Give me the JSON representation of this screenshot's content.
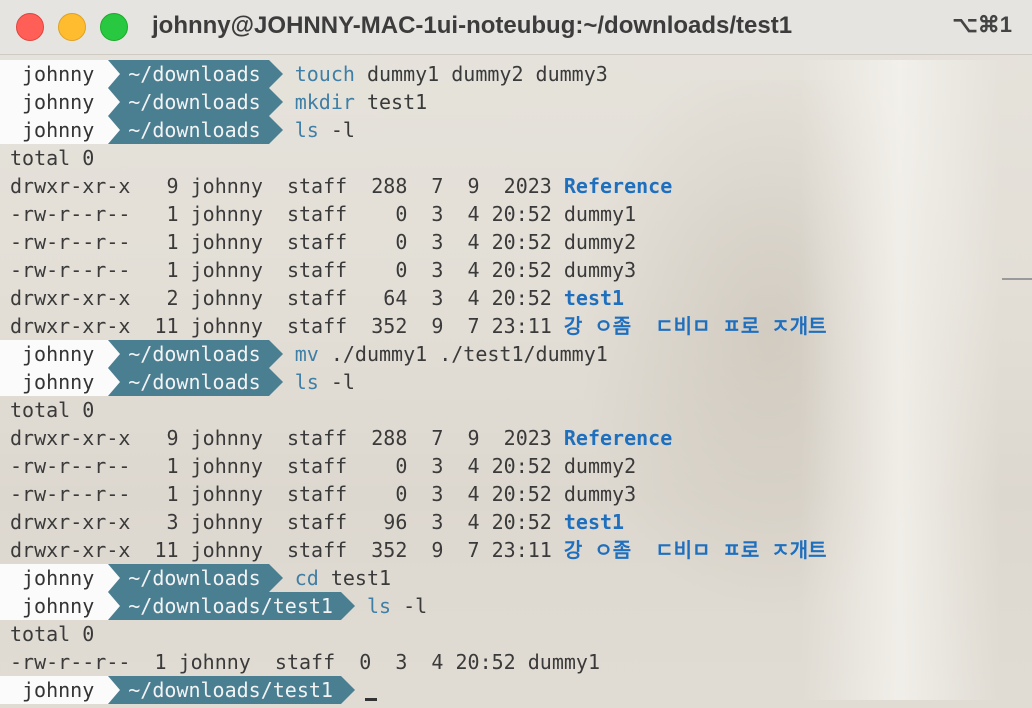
{
  "window": {
    "title": "johnny@JOHNNY-MAC-1ui-noteubug:~/downloads/test1",
    "shortcut": "⌥⌘1"
  },
  "lines": [
    {
      "type": "prompt",
      "user": "johnny",
      "dir": "~/downloads",
      "cmd": "touch",
      "args": " dummy1 dummy2 dummy3"
    },
    {
      "type": "prompt",
      "user": "johnny",
      "dir": "~/downloads",
      "cmd": "mkdir",
      "args": " test1"
    },
    {
      "type": "prompt",
      "user": "johnny",
      "dir": "~/downloads",
      "cmd": "ls",
      "args": " -l"
    },
    {
      "type": "out",
      "text": "total 0"
    },
    {
      "type": "ls",
      "text": "drwxr-xr-x   9 johnny  staff  288  7  9  2023 ",
      "name": "Reference",
      "dir": true
    },
    {
      "type": "ls",
      "text": "-rw-r--r--   1 johnny  staff    0  3  4 20:52 ",
      "name": "dummy1",
      "dir": false
    },
    {
      "type": "ls",
      "text": "-rw-r--r--   1 johnny  staff    0  3  4 20:52 ",
      "name": "dummy2",
      "dir": false
    },
    {
      "type": "ls",
      "text": "-rw-r--r--   1 johnny  staff    0  3  4 20:52 ",
      "name": "dummy3",
      "dir": false
    },
    {
      "type": "ls",
      "text": "drwxr-xr-x   2 johnny  staff   64  3  4 20:52 ",
      "name": "test1",
      "dir": true
    },
    {
      "type": "ls",
      "text": "drwxr-xr-x  11 johnny  staff  352  9  7 23:11 ",
      "name": "강 ㅇ좀  ㄷ비ㅁ ㅍ로 ㅈ개트",
      "dir": true
    },
    {
      "type": "prompt",
      "user": "johnny",
      "dir": "~/downloads",
      "cmd": "mv",
      "args": " ./dummy1 ./test1/dummy1"
    },
    {
      "type": "prompt",
      "user": "johnny",
      "dir": "~/downloads",
      "cmd": "ls",
      "args": " -l"
    },
    {
      "type": "out",
      "text": "total 0"
    },
    {
      "type": "ls",
      "text": "drwxr-xr-x   9 johnny  staff  288  7  9  2023 ",
      "name": "Reference",
      "dir": true
    },
    {
      "type": "ls",
      "text": "-rw-r--r--   1 johnny  staff    0  3  4 20:52 ",
      "name": "dummy2",
      "dir": false
    },
    {
      "type": "ls",
      "text": "-rw-r--r--   1 johnny  staff    0  3  4 20:52 ",
      "name": "dummy3",
      "dir": false
    },
    {
      "type": "ls",
      "text": "drwxr-xr-x   3 johnny  staff   96  3  4 20:52 ",
      "name": "test1",
      "dir": true
    },
    {
      "type": "ls",
      "text": "drwxr-xr-x  11 johnny  staff  352  9  7 23:11 ",
      "name": "강 ㅇ좀  ㄷ비ㅁ ㅍ로 ㅈ개트",
      "dir": true
    },
    {
      "type": "prompt",
      "user": "johnny",
      "dir": "~/downloads",
      "cmd": "cd",
      "args": " test1"
    },
    {
      "type": "prompt",
      "user": "johnny",
      "dir": "~/downloads/test1",
      "cmd": "ls",
      "args": " -l"
    },
    {
      "type": "out",
      "text": "total 0"
    },
    {
      "type": "ls",
      "text": "-rw-r--r--  1 johnny  staff  0  3  4 20:52 ",
      "name": "dummy1",
      "dir": false
    },
    {
      "type": "prompt",
      "user": "johnny",
      "dir": "~/downloads/test1",
      "cmd": "",
      "args": "",
      "cursor": true
    }
  ]
}
